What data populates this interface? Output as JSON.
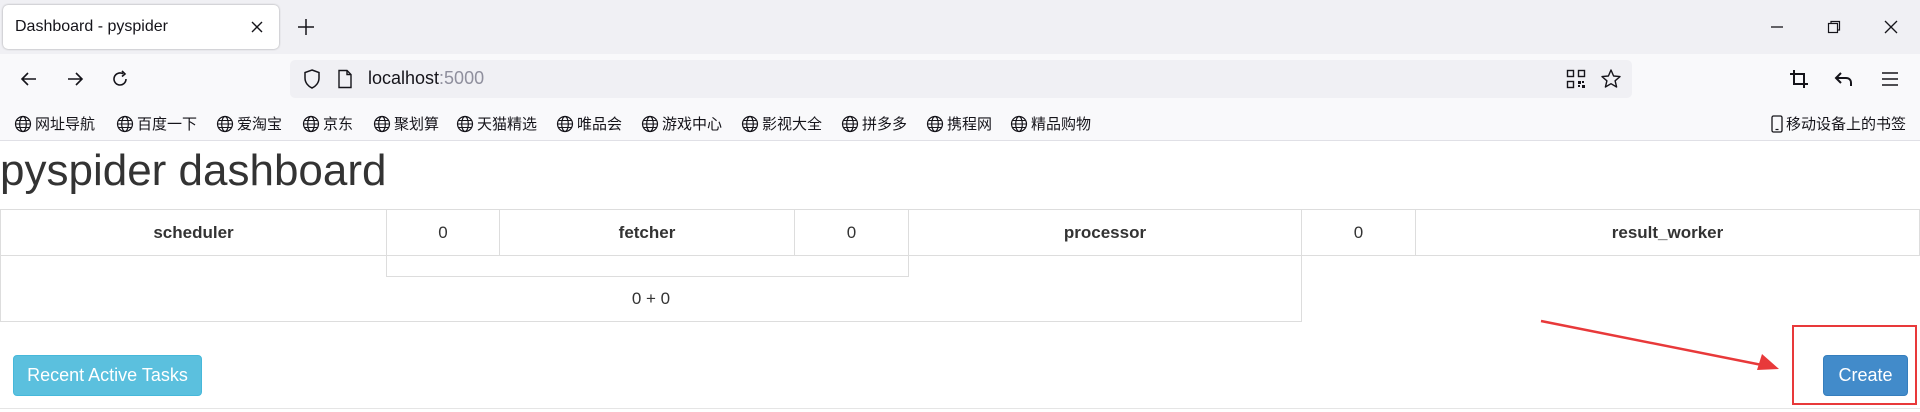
{
  "browser": {
    "tab_title": "Dashboard - pyspider",
    "url_host": "localhost",
    "url_port": ":5000",
    "bookmarks": [
      "网址导航",
      "百度一下",
      "爱淘宝",
      "京东",
      "聚划算",
      "天猫精选",
      "唯品会",
      "游戏中心",
      "影视大全",
      "拼多多",
      "携程网",
      "精品购物"
    ],
    "mobile_bookmarks": "移动设备上的书签"
  },
  "page": {
    "title": "pyspider dashboard",
    "components": [
      {
        "name": "scheduler",
        "value": "0"
      },
      {
        "name": "fetcher",
        "value": "0"
      },
      {
        "name": "processor",
        "value": "0"
      },
      {
        "name": "result_worker",
        "value": ""
      }
    ],
    "queue_summary": "0 + 0",
    "recent_button": "Recent Active Tasks",
    "create_button": "Create"
  },
  "colors": {
    "info_button": "#5bc0de",
    "primary_button": "#428bca",
    "annotation_red": "#e8393a"
  }
}
